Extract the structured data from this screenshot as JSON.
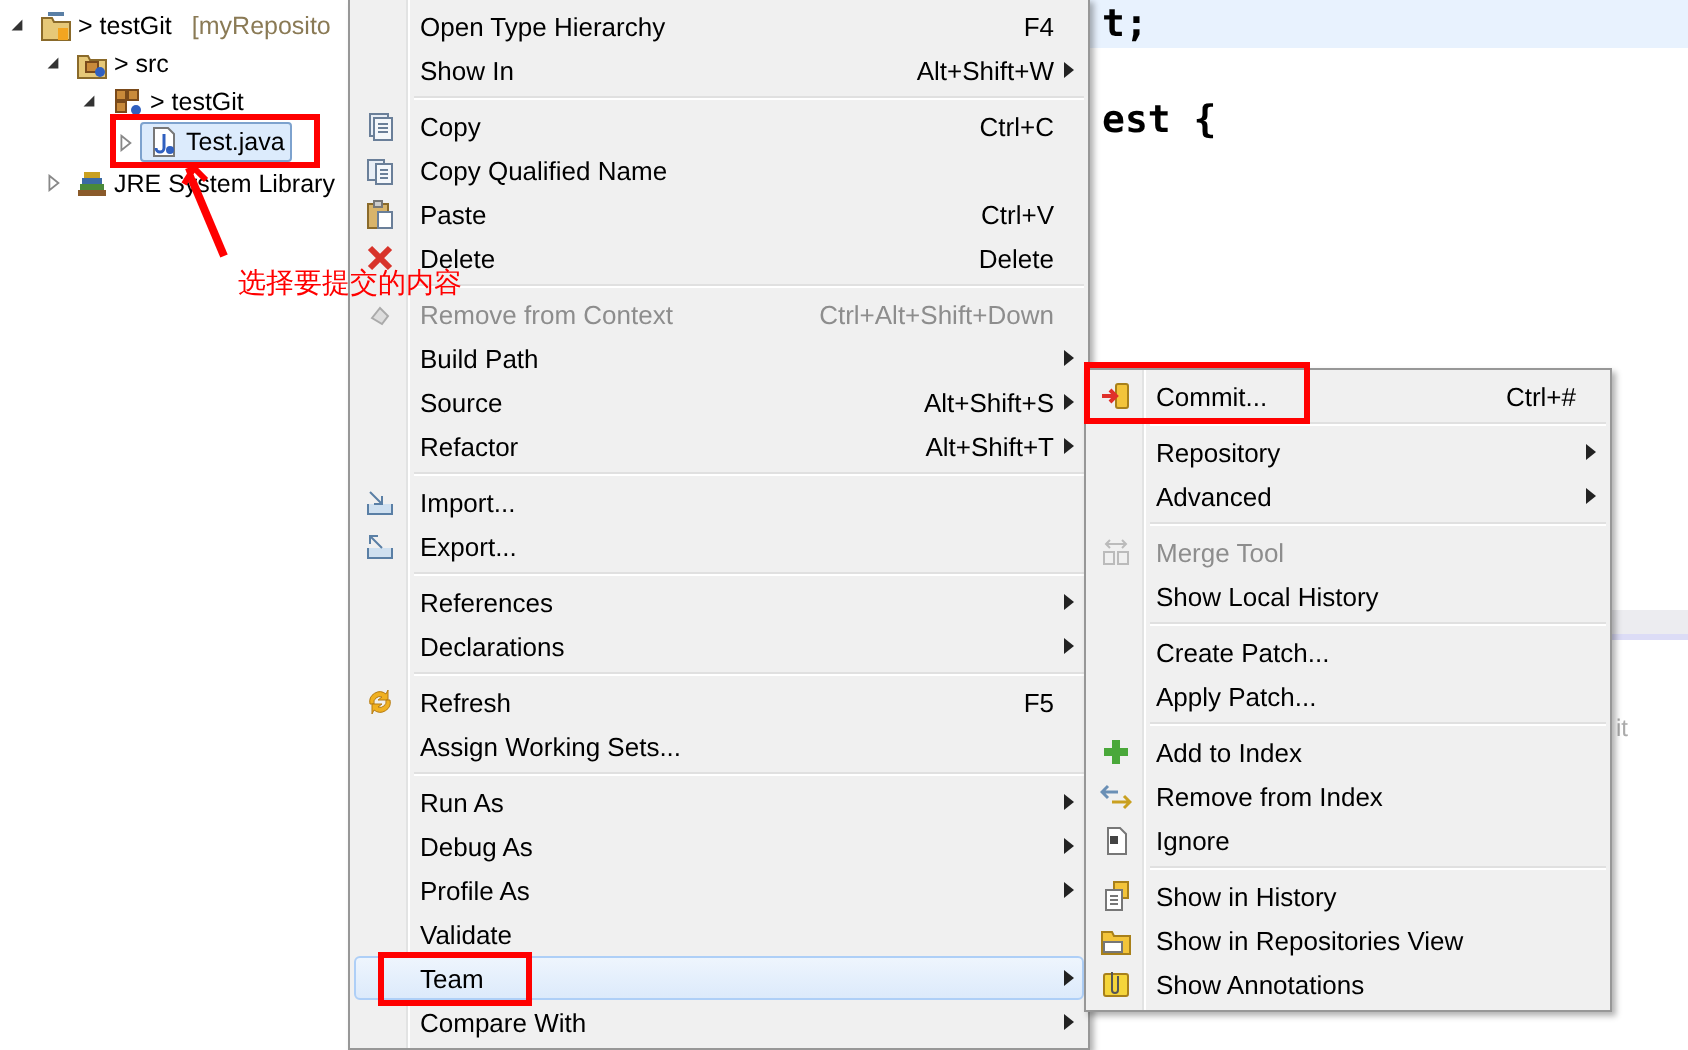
{
  "tree": [
    {
      "label": "> testGit",
      "suffix": "[myReposito",
      "kind": "project",
      "expanded": true,
      "selected": false,
      "children": [
        {
          "label": "> src",
          "kind": "source-folder",
          "expanded": true,
          "selected": false,
          "children": [
            {
              "label": "> testGit",
              "kind": "package",
              "expanded": true,
              "selected": false,
              "children": [
                {
                  "label": "Test.java",
                  "kind": "java-file",
                  "expanded": false,
                  "selected": true
                }
              ]
            }
          ]
        },
        {
          "label": "JRE System Library",
          "kind": "library",
          "expanded": false,
          "selected": false
        }
      ]
    }
  ],
  "editor": {
    "lines": [
      {
        "text": "t;",
        "highlighted": true
      },
      {
        "text": "est {",
        "highlighted": false
      }
    ],
    "lower_panel": {
      "text": "it"
    }
  },
  "context_menu": {
    "groups": [
      [
        {
          "label": "Open Type Hierarchy",
          "shortcut": "F4",
          "submenu": false,
          "disabled": false,
          "selected": false
        },
        {
          "label": "Show In",
          "shortcut": "Alt+Shift+W",
          "submenu": true,
          "disabled": false,
          "selected": false
        }
      ],
      [
        {
          "label": "Copy",
          "shortcut": "Ctrl+C",
          "kind": "copy",
          "submenu": false,
          "disabled": false,
          "selected": false
        },
        {
          "label": "Copy Qualified Name",
          "kind": "copy-name",
          "submenu": false,
          "disabled": false,
          "selected": false
        },
        {
          "label": "Paste",
          "shortcut": "Ctrl+V",
          "kind": "paste",
          "submenu": false,
          "disabled": false,
          "selected": false
        },
        {
          "label": "Delete",
          "shortcut": "Delete",
          "kind": "delete",
          "submenu": false,
          "disabled": false,
          "selected": false
        }
      ],
      [
        {
          "label": "Remove from Context",
          "shortcut": "Ctrl+Alt+Shift+Down",
          "kind": "remove-context",
          "submenu": false,
          "disabled": true,
          "selected": false
        },
        {
          "label": "Build Path",
          "submenu": true,
          "disabled": false,
          "selected": false
        },
        {
          "label": "Source",
          "shortcut": "Alt+Shift+S",
          "submenu": true,
          "disabled": false,
          "selected": false
        },
        {
          "label": "Refactor",
          "shortcut": "Alt+Shift+T",
          "submenu": true,
          "disabled": false,
          "selected": false
        }
      ],
      [
        {
          "label": "Import...",
          "kind": "import",
          "submenu": false,
          "disabled": false,
          "selected": false
        },
        {
          "label": "Export...",
          "kind": "export",
          "submenu": false,
          "disabled": false,
          "selected": false
        }
      ],
      [
        {
          "label": "References",
          "submenu": true,
          "disabled": false,
          "selected": false
        },
        {
          "label": "Declarations",
          "submenu": true,
          "disabled": false,
          "selected": false
        }
      ],
      [
        {
          "label": "Refresh",
          "shortcut": "F5",
          "kind": "refresh",
          "submenu": false,
          "disabled": false,
          "selected": false
        },
        {
          "label": "Assign Working Sets...",
          "submenu": false,
          "disabled": false,
          "selected": false
        }
      ],
      [
        {
          "label": "Run As",
          "submenu": true,
          "disabled": false,
          "selected": false
        },
        {
          "label": "Debug As",
          "submenu": true,
          "disabled": false,
          "selected": false
        },
        {
          "label": "Profile As",
          "submenu": true,
          "disabled": false,
          "selected": false
        },
        {
          "label": "Validate",
          "submenu": false,
          "disabled": false,
          "selected": false
        },
        {
          "label": "Team",
          "submenu": true,
          "disabled": false,
          "selected": true
        },
        {
          "label": "Compare With",
          "submenu": true,
          "disabled": false,
          "selected": false
        }
      ]
    ]
  },
  "team_submenu": {
    "groups": [
      [
        {
          "label": "Commit...",
          "shortcut": "Ctrl+#",
          "kind": "commit",
          "submenu": false,
          "disabled": false,
          "selected": false
        }
      ],
      [
        {
          "label": "Repository",
          "submenu": true,
          "disabled": false,
          "selected": false
        },
        {
          "label": "Advanced",
          "submenu": true,
          "disabled": false,
          "selected": false
        }
      ],
      [
        {
          "label": "Merge Tool",
          "kind": "merge",
          "submenu": false,
          "disabled": true,
          "selected": false
        },
        {
          "label": "Show Local History",
          "submenu": false,
          "disabled": false,
          "selected": false
        }
      ],
      [
        {
          "label": "Create Patch...",
          "submenu": false,
          "disabled": false,
          "selected": false
        },
        {
          "label": "Apply Patch...",
          "submenu": false,
          "disabled": false,
          "selected": false
        }
      ],
      [
        {
          "label": "Add to Index",
          "kind": "add",
          "submenu": false,
          "disabled": false,
          "selected": false
        },
        {
          "label": "Remove from Index",
          "kind": "remove-index",
          "submenu": false,
          "disabled": false,
          "selected": false
        },
        {
          "label": "Ignore",
          "kind": "ignore",
          "submenu": false,
          "disabled": false,
          "selected": false
        }
      ],
      [
        {
          "label": "Show in History",
          "kind": "history",
          "submenu": false,
          "disabled": false,
          "selected": false
        },
        {
          "label": "Show in Repositories View",
          "kind": "repositories",
          "submenu": false,
          "disabled": false,
          "selected": false
        },
        {
          "label": "Show Annotations",
          "kind": "annotations",
          "submenu": false,
          "disabled": false,
          "selected": false
        }
      ]
    ]
  },
  "annotation": {
    "label": "选择要提交的内容"
  }
}
